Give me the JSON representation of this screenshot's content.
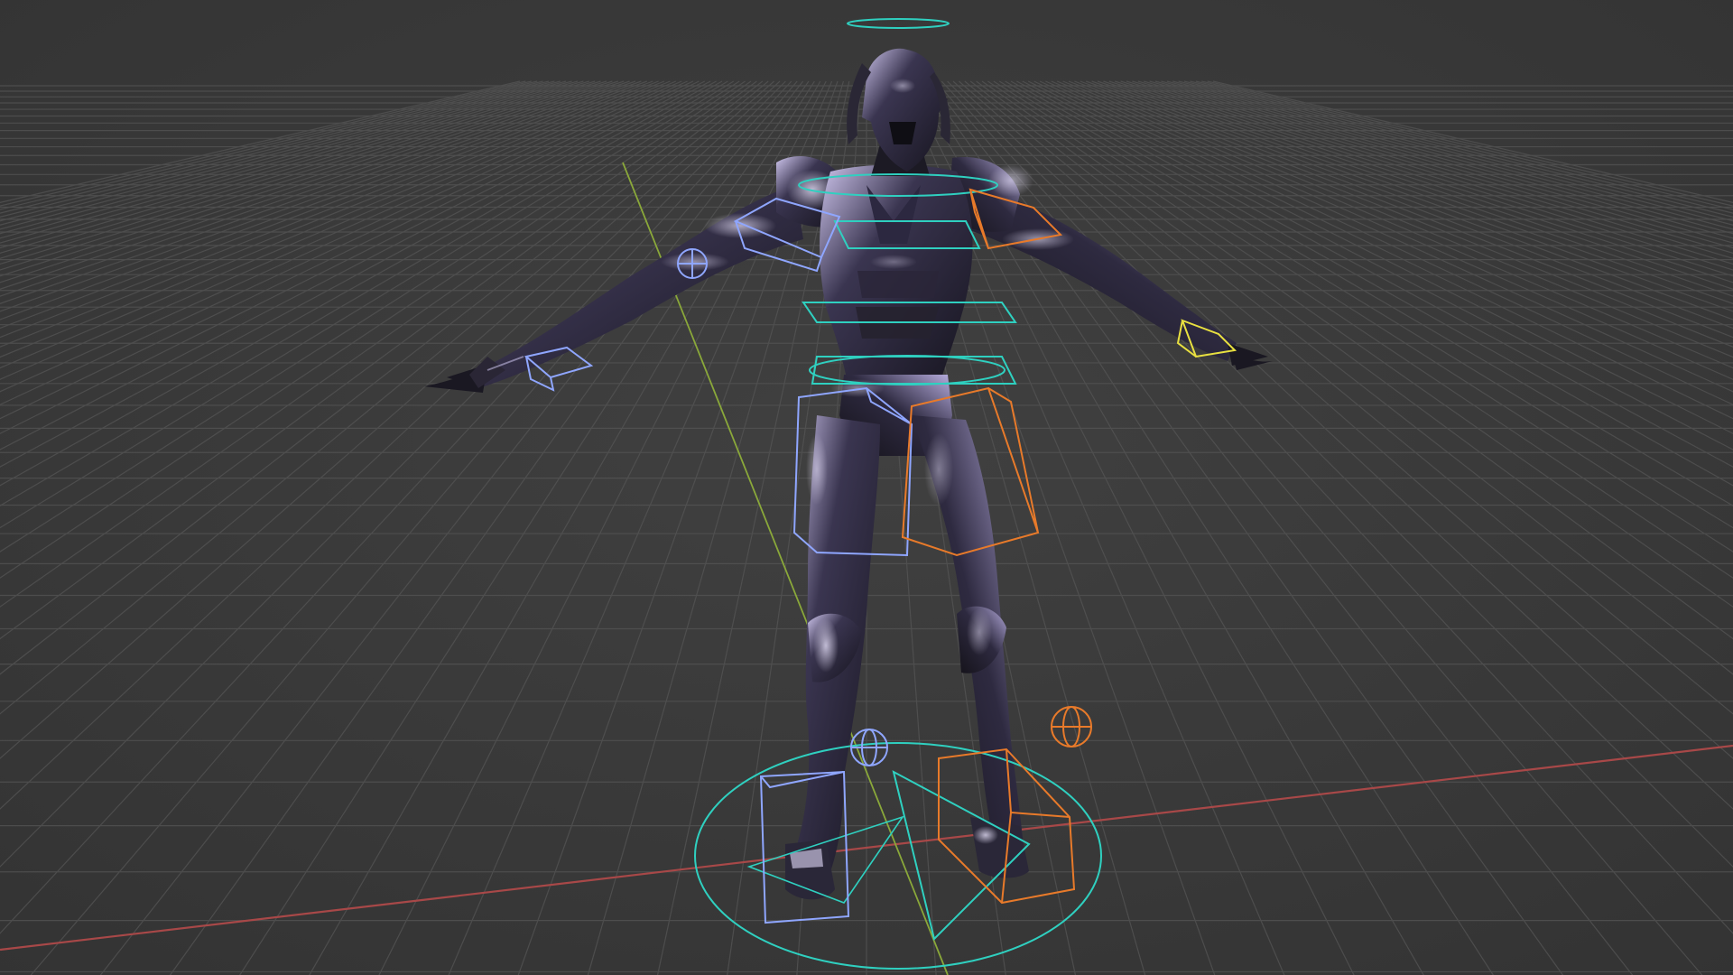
{
  "viewport": {
    "background_color": "#3b3b3b",
    "grid_color": "#555555",
    "x_axis_color": "#b04a4a",
    "y_axis_color": "#8aa83a",
    "controller_colors": {
      "body": "#2fd0c0",
      "left_side": "#8fa6ff",
      "right_side": "#e87a2a",
      "selected": "#e8e040"
    },
    "character": {
      "pose": "T-pose",
      "armor_base_color": "#1c1a26",
      "armor_highlight_color": "#c9bfe6"
    }
  }
}
